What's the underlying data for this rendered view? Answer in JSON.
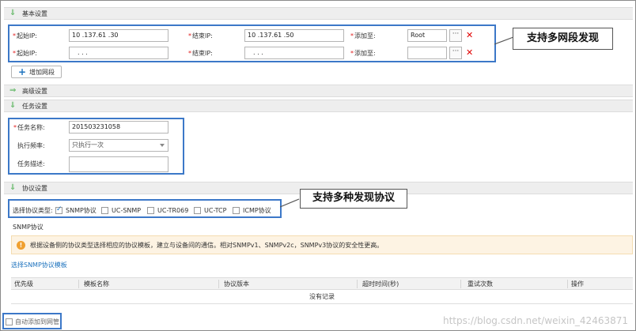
{
  "basic": {
    "section_title": "基本设置",
    "rows": [
      {
        "start_label": "起始IP:",
        "start_value": "10 .137.61 .30",
        "end_label": "结束IP:",
        "end_value": "10 .137.61 .50",
        "add_to_label": "添加至:",
        "add_to_value": "Root",
        "more": "···",
        "delete": "✕"
      },
      {
        "start_label": "起始IP:",
        "start_value": ".  .  .",
        "end_label": "结束IP:",
        "end_value": ".  .  .",
        "add_to_label": "添加至:",
        "add_to_value": "",
        "more": "···",
        "delete": "✕"
      }
    ],
    "add_segment_label": "增加网段",
    "callout": "支持多网段发现"
  },
  "advanced": {
    "section_title": "高级设置"
  },
  "task": {
    "section_title": "任务设置",
    "name_label": "任务名称:",
    "name_value": "201503231058",
    "freq_label": "执行频率:",
    "freq_value": "只执行一次",
    "desc_label": "任务描述:",
    "desc_value": ""
  },
  "protocol": {
    "section_title": "协议设置",
    "type_label": "选择协议类型:",
    "options": [
      {
        "label": "SNMP协议",
        "checked": true
      },
      {
        "label": "UC-SNMP",
        "checked": false
      },
      {
        "label": "UC-TR069",
        "checked": false
      },
      {
        "label": "UC-TCP",
        "checked": false
      },
      {
        "label": "ICMP协议",
        "checked": false
      }
    ],
    "callout": "支持多种发现协议",
    "snmp_title": "SNMP协议",
    "notice": "根据设备侧的协议类型选择相应的协议模板，建立与设备间的通信。相对SNMPv1、SNMPv2c，SNMPv3协议的安全性更高。",
    "template_link": "选择SNMP协议模板",
    "table": {
      "columns": [
        "优先级",
        "模板名称",
        "协议版本",
        "超时时间(秒)",
        "重试次数",
        "操作"
      ],
      "empty_text": "没有记录"
    }
  },
  "auto_add": {
    "label": "自动添加到网管",
    "checked": false
  },
  "watermark": "https://blog.csdn.net/weixin_42463871",
  "colors": {
    "accent": "#1e73be",
    "box_border": "#3c78c8",
    "delete": "#e00000",
    "arrow": "#4caf50"
  }
}
